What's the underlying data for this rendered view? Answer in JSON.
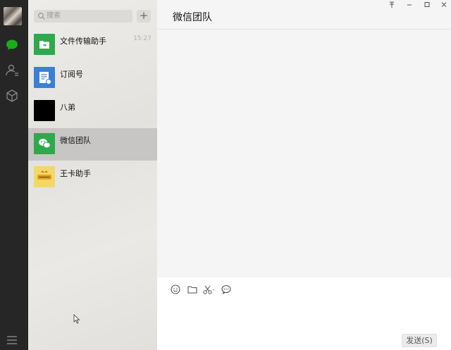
{
  "sidebar": {
    "icons": [
      "avatar",
      "chat-icon",
      "contacts-icon",
      "favorites-icon",
      "menu-icon"
    ],
    "accent": "#1aad19"
  },
  "search": {
    "placeholder": "搜索",
    "add_label": "+"
  },
  "sessions": [
    {
      "name": "文件传输助手",
      "time": "15:27",
      "icon": "file-transfer-icon",
      "color": "#2ea94c"
    },
    {
      "name": "订阅号",
      "time": "",
      "icon": "subscription-icon",
      "color": "#3b7fd6"
    },
    {
      "name": "八弟",
      "time": "",
      "icon": "avatar",
      "color": "#000000"
    },
    {
      "name": "微信团队",
      "time": "",
      "icon": "wechat-team-icon",
      "color": "#2ea94c"
    },
    {
      "name": "王卡助手",
      "time": "",
      "icon": "wangka-icon",
      "color": "#f3d868"
    }
  ],
  "chat": {
    "title": "微信团队",
    "send_label": "发送(S)",
    "window_controls": [
      "pin-icon",
      "minimize-icon",
      "maximize-icon",
      "close-icon"
    ],
    "toolbar": [
      "emoji-icon",
      "folder-icon",
      "scissors-icon",
      "chat-history-icon"
    ]
  }
}
